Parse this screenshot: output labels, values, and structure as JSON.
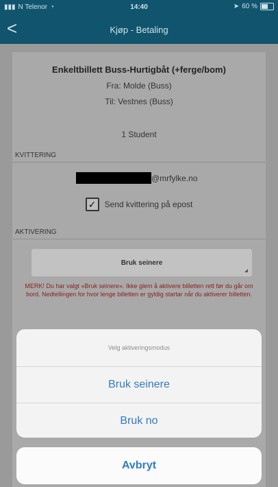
{
  "status_bar": {
    "carrier": "N Telenor",
    "time": "14:40",
    "battery": "60 %"
  },
  "nav": {
    "back_glyph": "<",
    "title": "Kjøp - Betaling"
  },
  "ticket": {
    "title": "Enkeltbillett Buss-Hurtigbåt (+ferge/bom)",
    "from": "Fra: Molde (Buss)",
    "to": "Til: Vestnes (Buss)",
    "passenger": "1 Student"
  },
  "receipt": {
    "section_label": "KVITTERING",
    "email_suffix": "@mrfylke.no",
    "send_label": "Send kvittering på epost",
    "send_checked": true
  },
  "activation": {
    "section_label": "AKTIVERING",
    "selected": "Bruk seinere",
    "warning": "MERK! Du har valgt «Bruk seinere». Ikke glem å aktivere billetten rett før du går om bord. Nedtellingen for hvor lenge billetten er gyldig startar når du aktiverer billetten."
  },
  "action_sheet": {
    "title": "Velg aktiveringsmodus",
    "options": [
      "Bruk seinere",
      "Bruk no"
    ],
    "cancel": "Avbryt"
  }
}
